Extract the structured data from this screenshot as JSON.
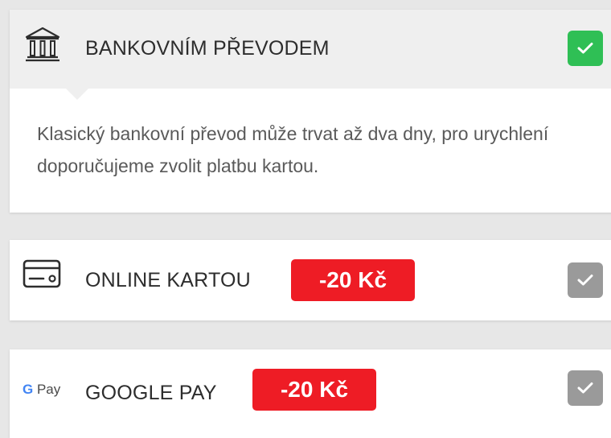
{
  "payment_options": [
    {
      "label": "BANKOVNÍM PŘEVODEM",
      "description": "Klasický bankovní převod může trvat až dva dny, pro urychlení doporučujeme zvolit platbu kartou.",
      "icon": "bank-icon",
      "selected": true
    },
    {
      "label": "ONLINE KARTOU",
      "badge": "-20 Kč",
      "icon": "credit-card-icon",
      "selected": false
    },
    {
      "label": "GOOGLE PAY",
      "badge": "-20 Kč",
      "icon": "google-pay-icon",
      "logo_g": "G",
      "logo_pay": "Pay",
      "selected": false
    }
  ],
  "colors": {
    "selected_check": "#2fbf55",
    "unselected_check": "#9a9a9a",
    "badge": "#ee1c25",
    "header_bg": "#efefef"
  }
}
